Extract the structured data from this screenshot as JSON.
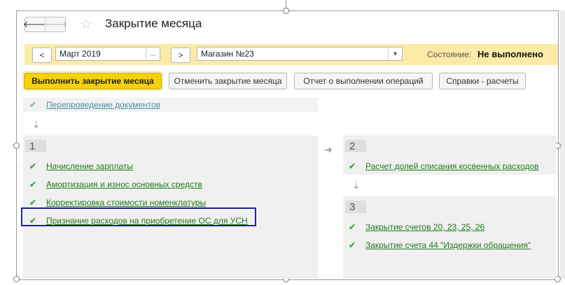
{
  "window": {
    "title": "Закрытие месяца"
  },
  "nav": {
    "back": "🡐",
    "forward": "🡒",
    "star": "☆"
  },
  "period": {
    "prev": "<",
    "next": ">",
    "value": "Март 2019",
    "choose": "..."
  },
  "org": {
    "value": "Магазин №23",
    "dropdown": "▾"
  },
  "status": {
    "label": "Состояние:",
    "value": "Не выполнено"
  },
  "toolbar": {
    "run": "Выполнить закрытие месяца",
    "cancel": "Отменить закрытие месяца",
    "report": "Отчет о выполнении операций",
    "refs": "Справки - расчеты"
  },
  "stage0": {
    "item": "Перепроведение документов"
  },
  "arrows": {
    "down": "⇣",
    "right": "➜"
  },
  "stage1": {
    "number": "1",
    "items": [
      "Начисление зарплаты",
      "Амортизация и износ основных средств",
      "Корректировка стоимости номенклатуры",
      "Признание расходов на приобретение ОС для УСН"
    ]
  },
  "stage2": {
    "number": "2",
    "items": [
      "Расчет долей списания косвенных расходов"
    ]
  },
  "stage3": {
    "number": "3",
    "items": [
      "Закрытие счетов 20, 23, 25, 26",
      "Закрытие счета 44 \"Издержки обращения\""
    ]
  },
  "check": "✔",
  "colors": {
    "accent": "#f5d10c",
    "bar": "#fbeba7",
    "link": "#1d7a1d",
    "selection": "#1f1f9a"
  }
}
